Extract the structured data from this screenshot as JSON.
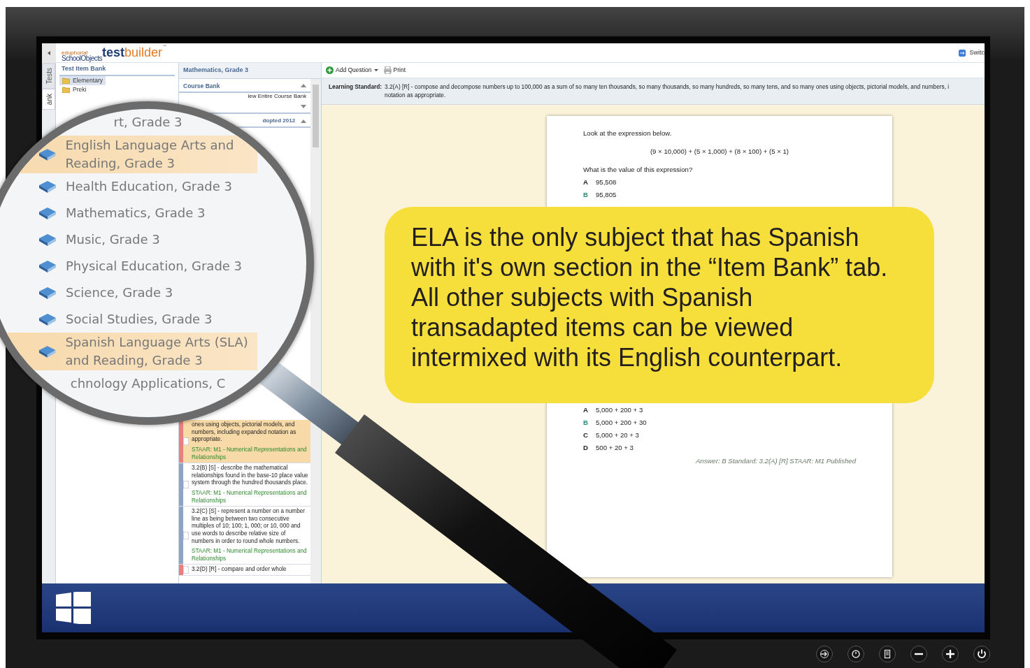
{
  "header": {
    "logo_tag": "eduphoria!",
    "logo_brand": "SchoolObjects",
    "logo_product_a": "test",
    "logo_product_b": "builder",
    "trademark": "™",
    "switch": "Switc"
  },
  "side_tabs": [
    {
      "label": "Tests",
      "selected": false
    },
    {
      "label": "ank",
      "selected": true
    }
  ],
  "item_bank": {
    "title": "Test Item Bank",
    "folders": [
      {
        "label": "Elementary",
        "selected": true
      },
      {
        "label": "Preki",
        "selected": false
      }
    ]
  },
  "course": {
    "title": "Mathematics, Grade 3",
    "section": "Course Bank",
    "link": "iew Entire Course Bank",
    "adopted": "dopted 2012",
    "standards": [
      {
        "text": "ones using objects, pictorial models, and numbers, including expanded notation as appropriate.",
        "staar": "STAAR: M1 - Numerical Representations and Relationships",
        "color": "#e98080",
        "selected": true
      },
      {
        "text": "3.2(B) [S] - describe the mathematical relationships found in the base-10 place value system through the hundred thousands place.",
        "staar": "STAAR: M1 - Numerical Representations and Relationships",
        "color": "#8ea5c8",
        "selected": false
      },
      {
        "text": "3.2(C) [S] - represent a number on a number line as being between two consecutive multiples of 10; 100; 1, 000; or 10, 000 and use words to describe relative size of numbers in order to round whole numbers.",
        "staar": "STAAR: M1 - Numerical Representations and Relationships",
        "color": "#8ea5c8",
        "selected": false
      },
      {
        "text": "3.2(D) [R] - compare and order whole",
        "color": "#e98080",
        "selected": false
      }
    ]
  },
  "toolbar": {
    "add_question": "Add Question",
    "print": "Print"
  },
  "learning_standard": {
    "label": "Learning Standard:",
    "lines": [
      "3.2(A) [R] - compose and decompose numbers up to 100,000 as a sum of so many ten thousands, so many thousands, so many hundreds, so many tens, and so many ones using objects, pictorial models, and numbers, i",
      "notation as appropriate."
    ]
  },
  "questions": [
    {
      "prompt": "Look at the expression below.",
      "expression": "(9 × 10,000) + (5 × 1,000) + (8 × 100) + (5 × 1)",
      "question": "What is the value of this expression?",
      "choices": [
        {
          "letter": "A",
          "text": "95,508",
          "correct": false
        },
        {
          "letter": "B",
          "text": "95,805",
          "correct": true
        }
      ]
    },
    {
      "choices": [
        {
          "letter": "A",
          "text": "5,000 + 200 + 3",
          "correct": false
        },
        {
          "letter": "B",
          "text": "5,000 + 200 + 30",
          "correct": true
        },
        {
          "letter": "C",
          "text": "5,000 + 20 + 3",
          "correct": false
        },
        {
          "letter": "D",
          "text": "500 + 20 + 3",
          "correct": false
        }
      ],
      "answer": "Answer: B  Standard: 3.2(A) [R]  STAAR: M1  Published"
    }
  ],
  "magnifier": {
    "items": [
      {
        "label": "rt, Grade 3",
        "kind": "cut",
        "selected": false
      },
      {
        "label": "English Language Arts and Reading, Grade 3",
        "kind": "course",
        "selected": true
      },
      {
        "label": "Health Education, Grade 3",
        "kind": "course",
        "selected": false
      },
      {
        "label": "Mathematics, Grade 3",
        "kind": "course",
        "selected": false
      },
      {
        "label": "Music, Grade 3",
        "kind": "course",
        "selected": false
      },
      {
        "label": "Physical Education, Grade 3",
        "kind": "course",
        "selected": false
      },
      {
        "label": "Science, Grade 3",
        "kind": "course",
        "selected": false
      },
      {
        "label": "Social Studies, Grade 3",
        "kind": "course",
        "selected": false
      },
      {
        "label": "Spanish Language Arts (SLA) and Reading, Grade 3",
        "kind": "course",
        "selected": true
      },
      {
        "label": "chnology Applications, C",
        "kind": "cut",
        "selected": false
      }
    ]
  },
  "callout": {
    "lines": [
      "ELA is the only subject that has Spanish",
      "with it's own section in the “Item Bank” tab.",
      "All other subjects with Spanish",
      "transadapted items can be viewed",
      "intermixed with its English counterpart."
    ]
  }
}
